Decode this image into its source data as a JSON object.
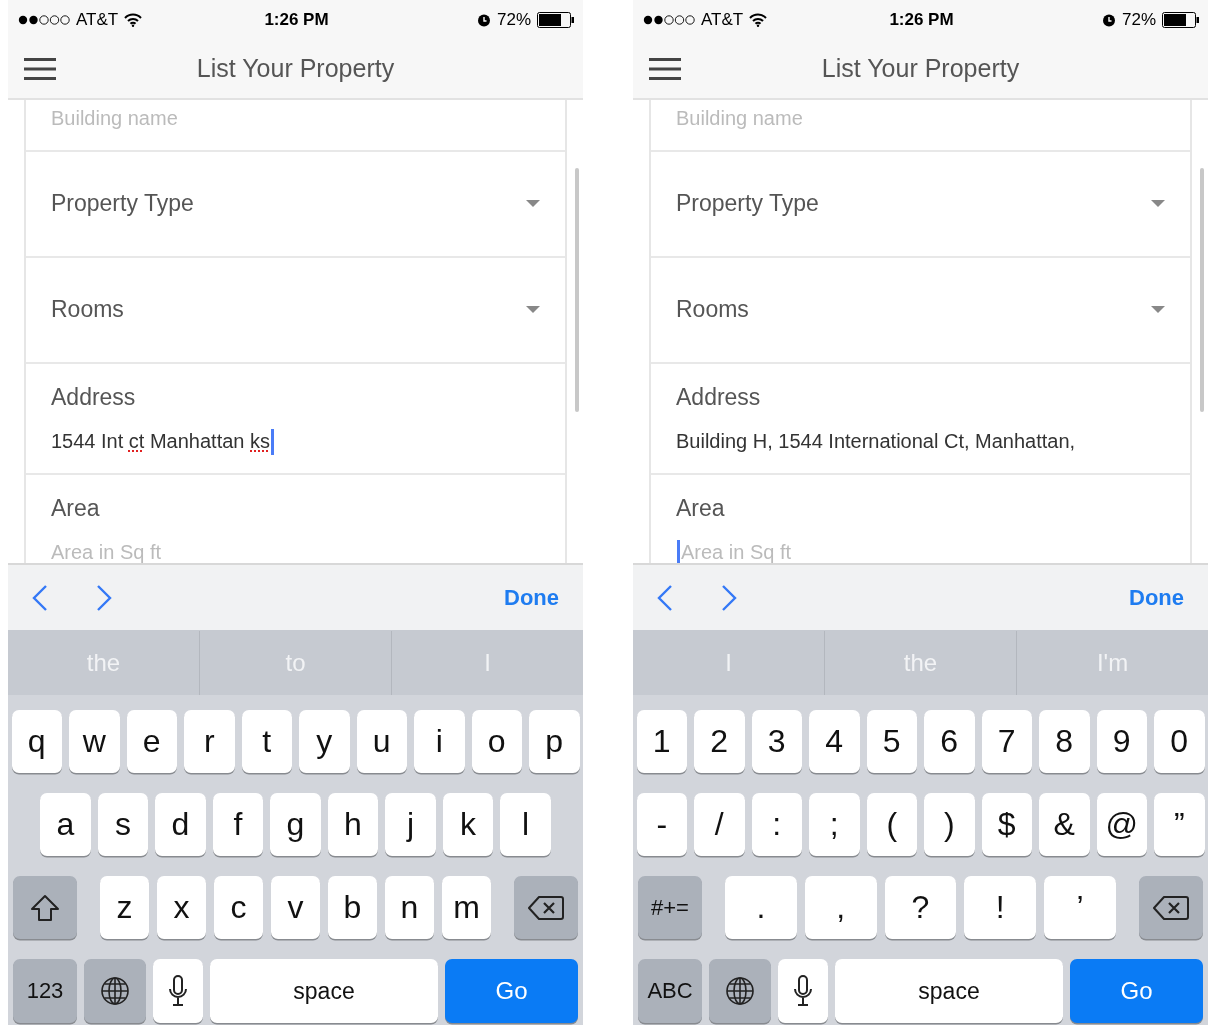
{
  "phones": [
    {
      "status": {
        "carrier": "AT&T",
        "time": "1:26 PM",
        "battery": "72%"
      },
      "title": "List Your Property",
      "fields": [
        {
          "kind": "text",
          "placeholder": "Building name",
          "focused": false
        },
        {
          "kind": "select",
          "label": "Property Type"
        },
        {
          "kind": "select",
          "label": "Rooms"
        },
        {
          "kind": "text",
          "label": "Address",
          "value_parts": [
            {
              "text": "1544 Int ",
              "misspelled": false
            },
            {
              "text": "ct",
              "misspelled": true
            },
            {
              "text": " Manhattan ",
              "misspelled": false
            },
            {
              "text": "ks",
              "misspelled": true
            }
          ],
          "focused": true
        },
        {
          "kind": "text",
          "label": "Area",
          "placeholder": "Area in Sq ft",
          "focused": false
        }
      ],
      "accessory": {
        "done": "Done"
      },
      "suggestions": [
        "the",
        "to",
        "I"
      ],
      "keyboard": [
        [
          {
            "kind": "char",
            "label": "q"
          },
          {
            "kind": "char",
            "label": "w"
          },
          {
            "kind": "char",
            "label": "e"
          },
          {
            "kind": "char",
            "label": "r"
          },
          {
            "kind": "char",
            "label": "t"
          },
          {
            "kind": "char",
            "label": "y"
          },
          {
            "kind": "char",
            "label": "u"
          },
          {
            "kind": "char",
            "label": "i"
          },
          {
            "kind": "char",
            "label": "o"
          },
          {
            "kind": "char",
            "label": "p"
          }
        ],
        [
          {
            "kind": "char",
            "label": "a"
          },
          {
            "kind": "char",
            "label": "s"
          },
          {
            "kind": "char",
            "label": "d"
          },
          {
            "kind": "char",
            "label": "f"
          },
          {
            "kind": "char",
            "label": "g"
          },
          {
            "kind": "char",
            "label": "h"
          },
          {
            "kind": "char",
            "label": "j"
          },
          {
            "kind": "char",
            "label": "k"
          },
          {
            "kind": "char",
            "label": "l"
          }
        ],
        [
          {
            "kind": "shift"
          },
          {
            "kind": "char",
            "label": "z"
          },
          {
            "kind": "char",
            "label": "x"
          },
          {
            "kind": "char",
            "label": "c"
          },
          {
            "kind": "char",
            "label": "v"
          },
          {
            "kind": "char",
            "label": "b"
          },
          {
            "kind": "char",
            "label": "n"
          },
          {
            "kind": "char",
            "label": "m"
          },
          {
            "kind": "delete"
          }
        ],
        [
          {
            "kind": "mode",
            "label": "123"
          },
          {
            "kind": "globe"
          },
          {
            "kind": "mic"
          },
          {
            "kind": "space",
            "label": "space"
          },
          {
            "kind": "go",
            "label": "Go"
          }
        ]
      ]
    },
    {
      "status": {
        "carrier": "AT&T",
        "time": "1:26 PM",
        "battery": "72%"
      },
      "title": "List Your Property",
      "fields": [
        {
          "kind": "text",
          "placeholder": "Building name",
          "focused": false
        },
        {
          "kind": "select",
          "label": "Property Type"
        },
        {
          "kind": "select",
          "label": "Rooms"
        },
        {
          "kind": "text",
          "label": "Address",
          "value_parts": [
            {
              "text": "Building H, 1544 International Ct, Manhattan,",
              "misspelled": false
            }
          ],
          "focused": false
        },
        {
          "kind": "text",
          "label": "Area",
          "placeholder": "Area in Sq ft",
          "focused": true
        }
      ],
      "accessory": {
        "done": "Done"
      },
      "suggestions": [
        "I",
        "the",
        "I'm"
      ],
      "keyboard": [
        [
          {
            "kind": "char",
            "label": "1"
          },
          {
            "kind": "char",
            "label": "2"
          },
          {
            "kind": "char",
            "label": "3"
          },
          {
            "kind": "char",
            "label": "4"
          },
          {
            "kind": "char",
            "label": "5"
          },
          {
            "kind": "char",
            "label": "6"
          },
          {
            "kind": "char",
            "label": "7"
          },
          {
            "kind": "char",
            "label": "8"
          },
          {
            "kind": "char",
            "label": "9"
          },
          {
            "kind": "char",
            "label": "0"
          }
        ],
        [
          {
            "kind": "char",
            "label": "-"
          },
          {
            "kind": "char",
            "label": "/"
          },
          {
            "kind": "char",
            "label": ":"
          },
          {
            "kind": "char",
            "label": ";"
          },
          {
            "kind": "char",
            "label": "("
          },
          {
            "kind": "char",
            "label": ")"
          },
          {
            "kind": "char",
            "label": "$"
          },
          {
            "kind": "char",
            "label": "&"
          },
          {
            "kind": "char",
            "label": "@"
          },
          {
            "kind": "char",
            "label": "”"
          }
        ],
        [
          {
            "kind": "mode",
            "label": "#+="
          },
          {
            "kind": "char",
            "label": "."
          },
          {
            "kind": "char",
            "label": ","
          },
          {
            "kind": "char",
            "label": "?"
          },
          {
            "kind": "char",
            "label": "!"
          },
          {
            "kind": "char",
            "label": "’"
          },
          {
            "kind": "delete"
          }
        ],
        [
          {
            "kind": "mode",
            "label": "ABC"
          },
          {
            "kind": "globe"
          },
          {
            "kind": "mic"
          },
          {
            "kind": "space",
            "label": "space"
          },
          {
            "kind": "go",
            "label": "Go"
          }
        ]
      ]
    }
  ]
}
